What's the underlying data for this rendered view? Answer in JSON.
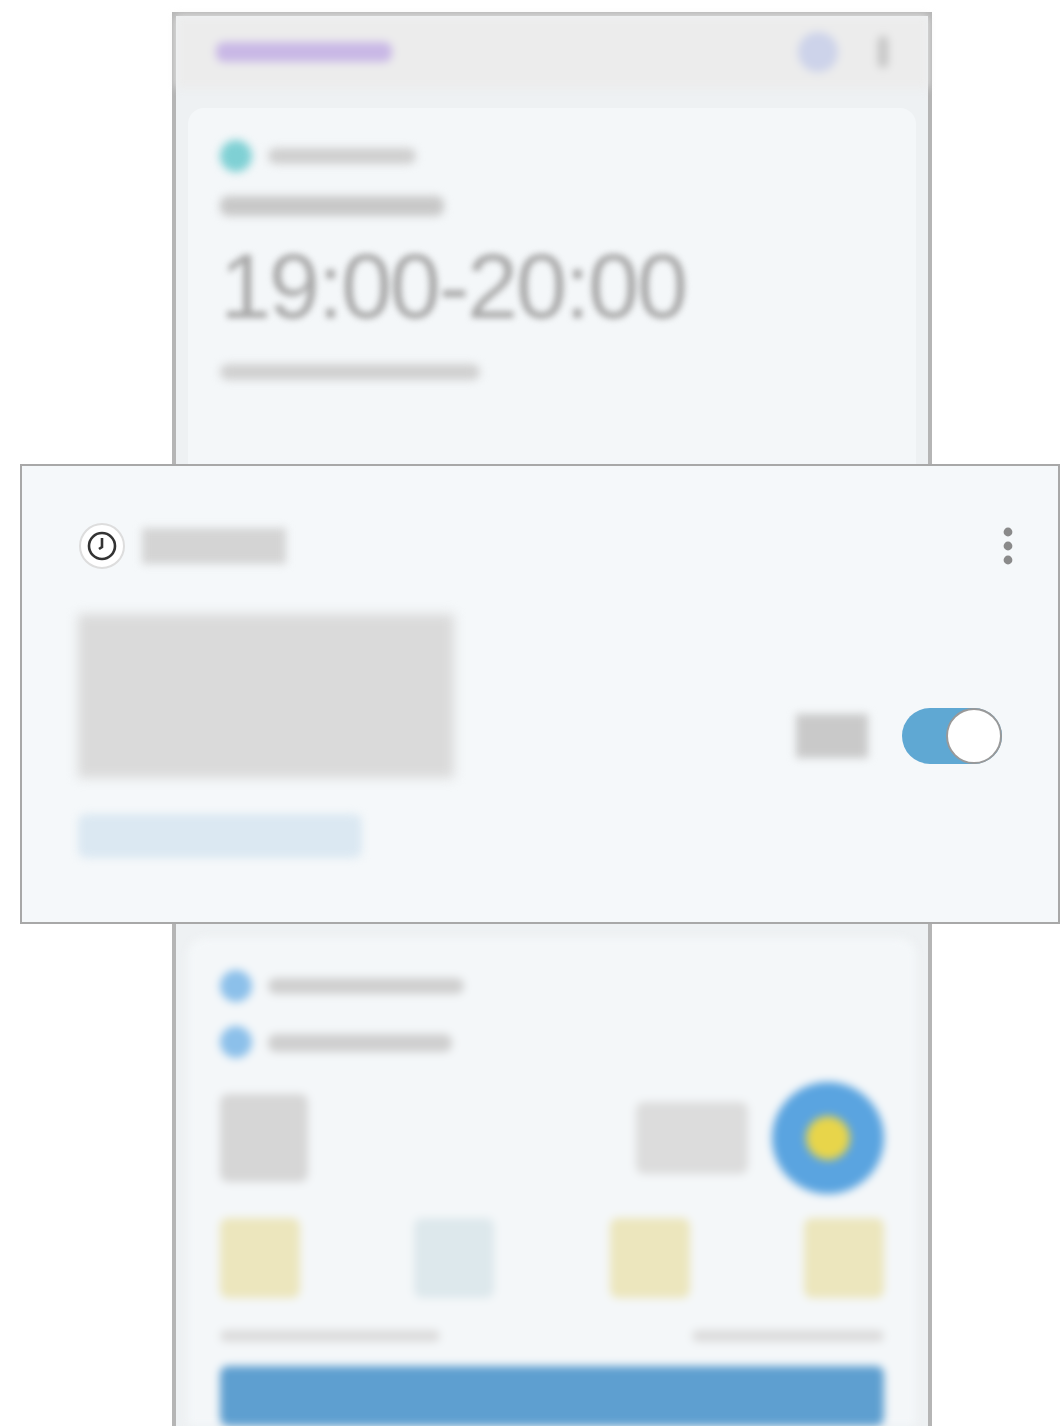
{
  "background_card": {
    "time_range": "19:00-20:00"
  },
  "alarm_card": {
    "switch_on": true
  }
}
